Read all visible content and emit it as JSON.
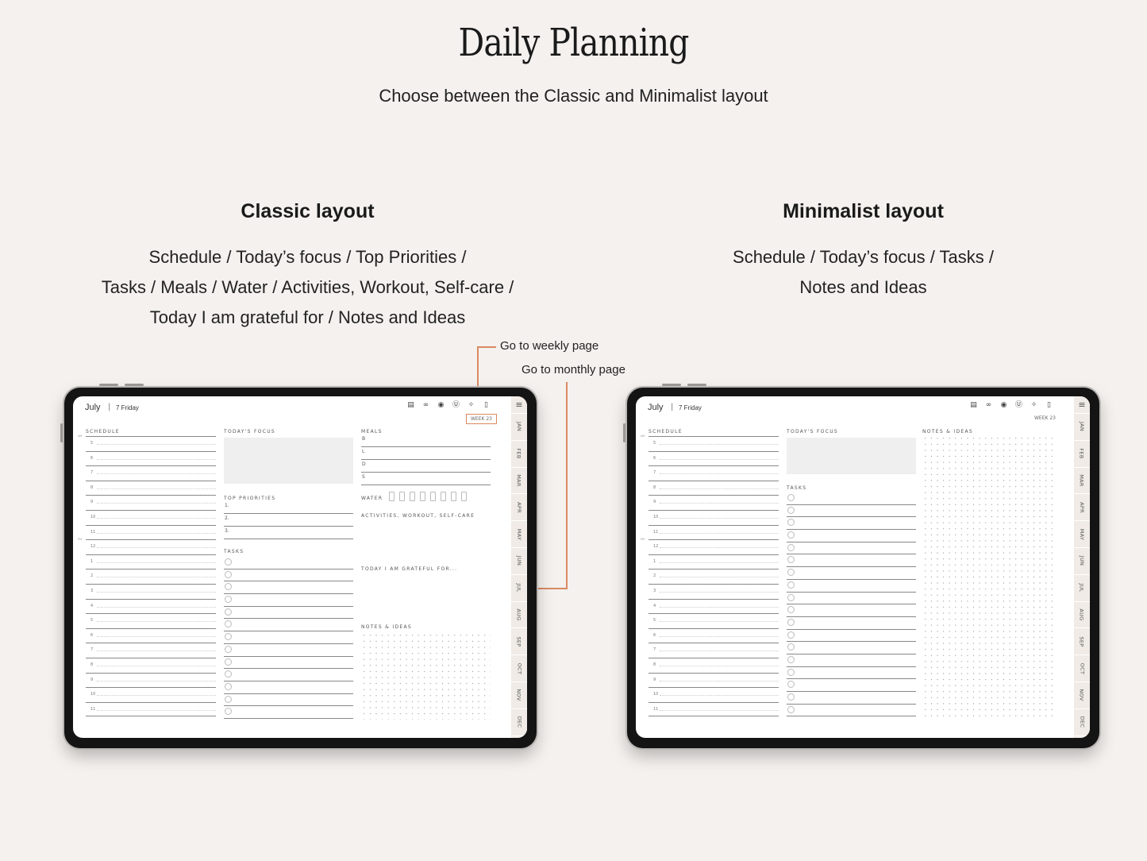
{
  "page": {
    "title": "Daily Planning",
    "subtitle": "Choose between the Classic and Minimalist layout"
  },
  "classic": {
    "heading": "Classic layout",
    "desc_lines": [
      "Schedule / Today’s focus / Top Priorities /",
      "Tasks / Meals / Water / Activities, Workout, Self-care /",
      "Today I am grateful for / Notes and Ideas"
    ]
  },
  "minimalist": {
    "heading": "Minimalist layout",
    "desc_lines": [
      "Schedule / Today’s focus / Tasks /",
      "Notes and Ideas"
    ]
  },
  "callouts": {
    "weekly": "Go to weekly page",
    "monthly": "Go to monthly page",
    "accent_color": "#d98a62"
  },
  "planner": {
    "month": "July",
    "separator": "|",
    "day": "7 Friday",
    "week": "WEEK 23",
    "header_icons": [
      "notepad-icon",
      "dumbbell-icon",
      "cooking-pot-icon",
      "dollar-icon",
      "sparkle-icon",
      "page-icon"
    ],
    "menu_icon": "≡",
    "months": [
      "JAN",
      "FEB",
      "MAR",
      "APR",
      "MAY",
      "JUN",
      "JUL",
      "AUG",
      "SEP",
      "OCT",
      "NOV",
      "DEC"
    ],
    "labels": {
      "schedule": "SCHEDULE",
      "focus": "TODAY'S FOCUS",
      "priorities": "TOP PRIORITIES",
      "tasks": "TASKS",
      "meals": "MEALS",
      "water": "WATER",
      "activities": "ACTIVITIES, WORKOUT, SELF-CARE",
      "grateful": "TODAY I AM GRATEFUL FOR...",
      "notes": "NOTES & IDEAS",
      "am": "AM",
      "pm": "PM"
    },
    "hours": [
      "5",
      "6",
      "7",
      "8",
      "9",
      "10",
      "11",
      "12",
      "1",
      "2",
      "3",
      "4",
      "5",
      "6",
      "7",
      "8",
      "9",
      "10",
      "11"
    ],
    "priorities": [
      "1.",
      "2.",
      "3."
    ],
    "meals": [
      "B",
      "L",
      "D",
      "S"
    ],
    "water_glasses": 8,
    "classic_task_count": 13,
    "minimal_task_count": 18
  }
}
